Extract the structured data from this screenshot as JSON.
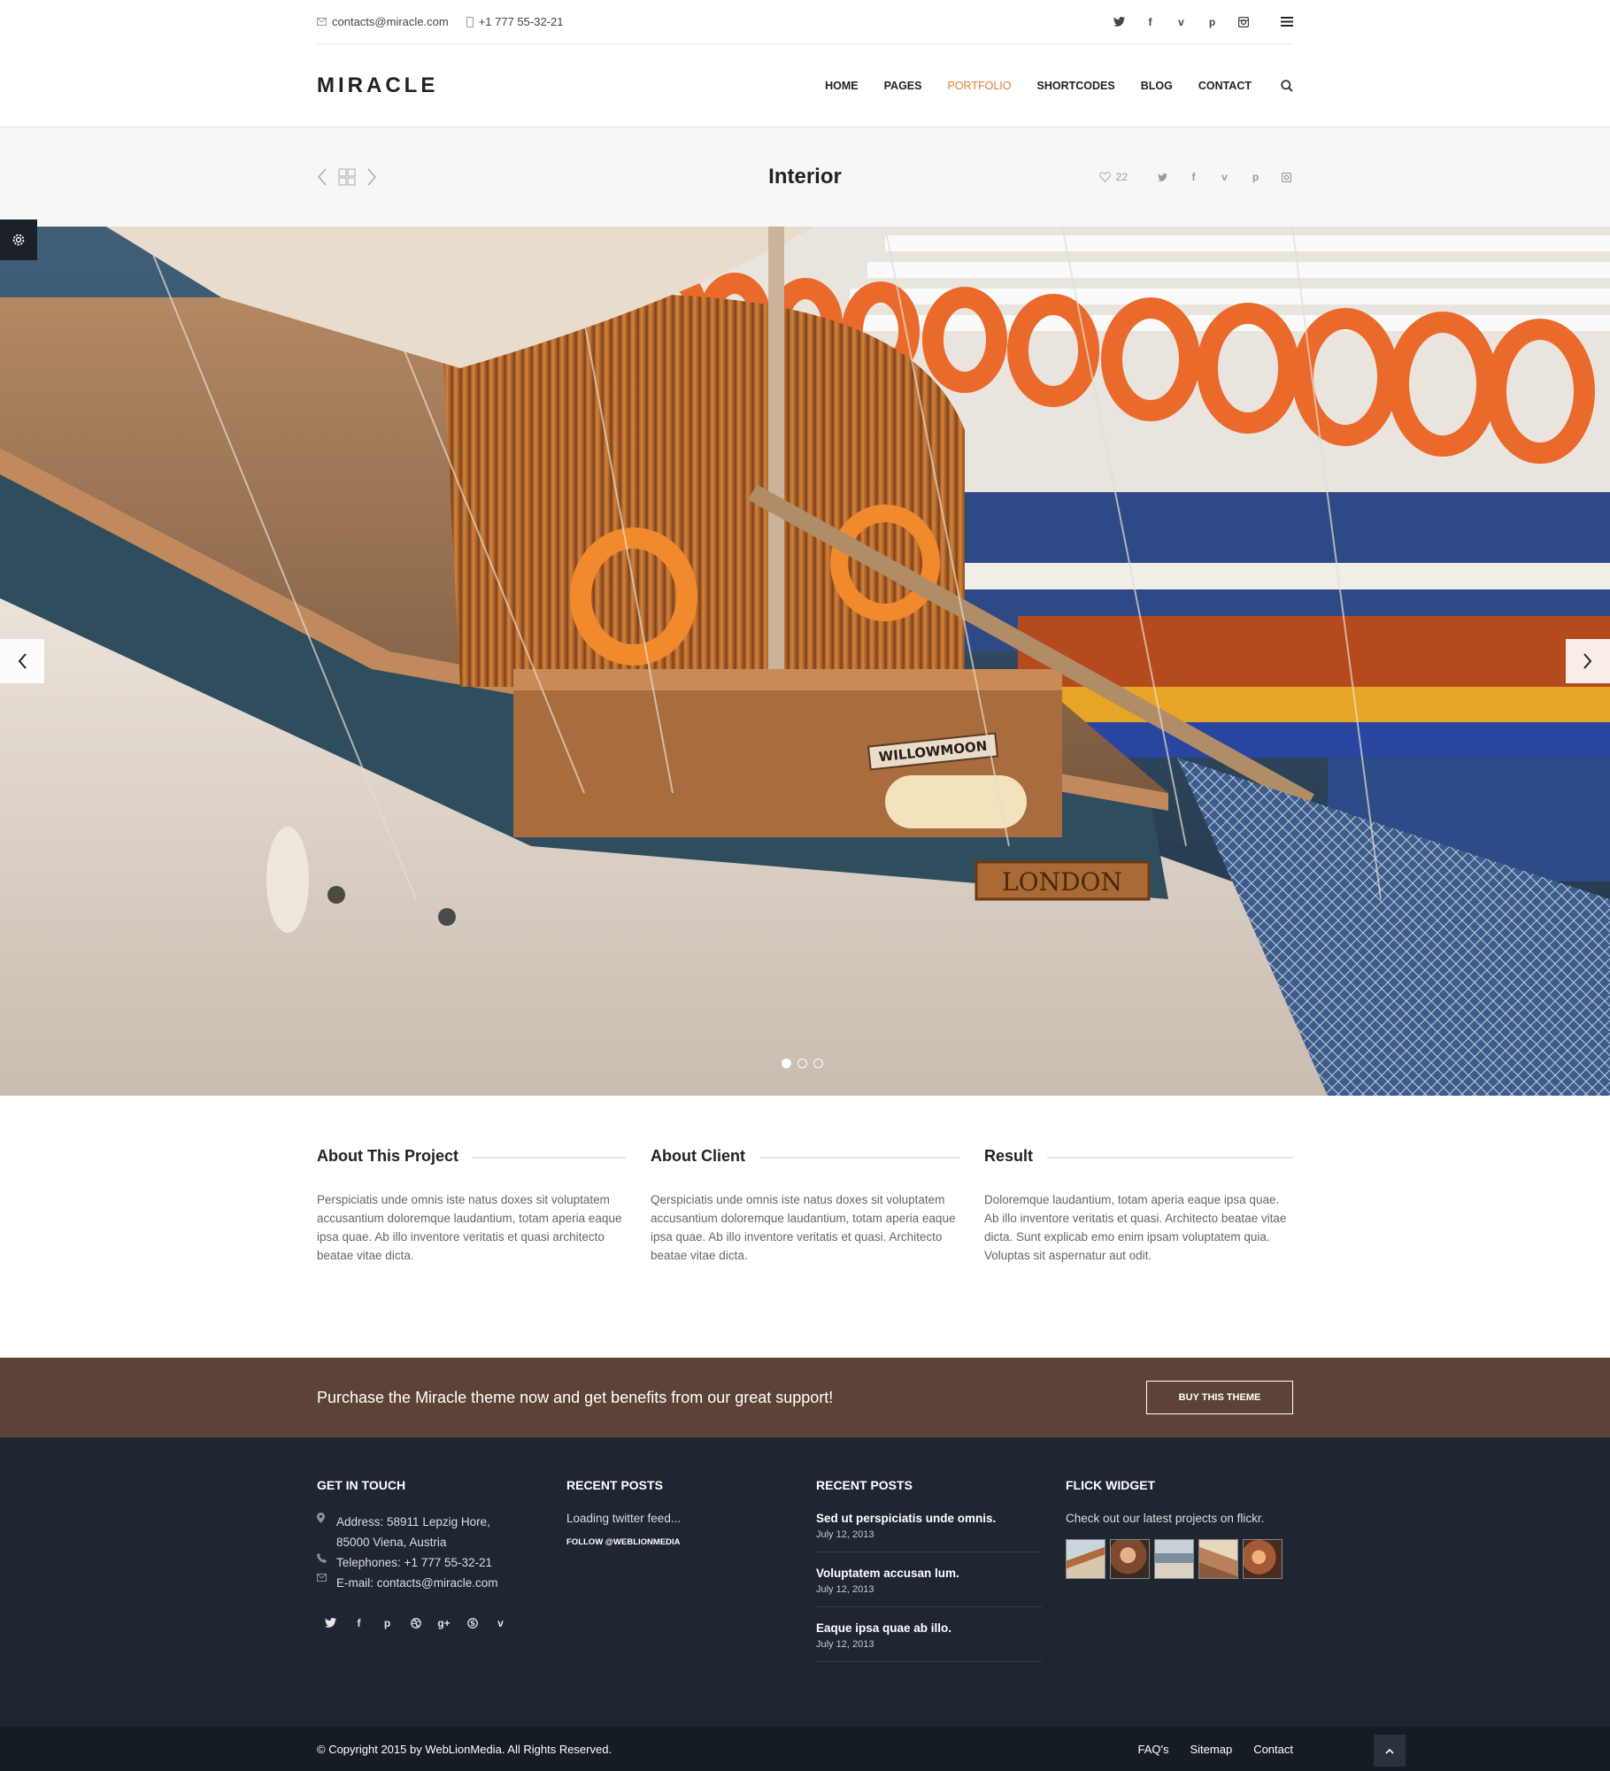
{
  "topbar": {
    "email": "contacts@miracle.com",
    "phone": "+1 777 55-32-21",
    "social": [
      "twitter-icon",
      "facebook-icon",
      "vimeo-icon",
      "pinterest-icon",
      "instagram-icon"
    ]
  },
  "header": {
    "logo": "MIRACLE",
    "nav": [
      "HOME",
      "PAGES",
      "PORTFOLIO",
      "SHORTCODES",
      "BLOG",
      "CONTACT"
    ],
    "active_nav": "PORTFOLIO"
  },
  "titlebar": {
    "title": "Interior",
    "likes": "22"
  },
  "slider": {
    "boat_name": "WILLOWMOON",
    "hull_name": "LONDON",
    "slides": 3,
    "active_slide": 1
  },
  "about": [
    {
      "title": "About This Project",
      "text": "Perspiciatis unde omnis iste natus doxes sit voluptatem accusantium doloremque laudantium, totam aperia eaque ipsa quae. Ab illo inventore veritatis et quasi architecto beatae vitae dicta."
    },
    {
      "title": "About Client",
      "text": "Qerspiciatis unde omnis iste natus doxes sit voluptatem accusantium doloremque laudantium, totam aperia eaque ipsa quae. Ab illo inventore veritatis et quasi. Architecto beatae vitae dicta."
    },
    {
      "title": "Result",
      "text": "Doloremque laudantium, totam aperia eaque ipsa quae. Ab illo inventore veritatis et quasi. Architecto beatae vitae dicta. Sunt explicab emo enim ipsam voluptatem quia. Voluptas sit aspernatur aut odit."
    }
  ],
  "cta": {
    "text": "Purchase the Miracle theme now and get benefits from our great support!",
    "button": "BUY THIS THEME"
  },
  "footer": {
    "get_in_touch": {
      "title": "GET IN TOUCH",
      "address": "Address: 58911 Lepzig Hore,",
      "address2": "85000 Viena, Austria",
      "telephone": "Telephones: +1 777 55-32-21",
      "email": "E-mail: contacts@miracle.com"
    },
    "recent_twitter": {
      "title": "RECENT POSTS",
      "loading": "Loading twitter feed...",
      "follow": "FOLLOW @WEBLIONMEDIA"
    },
    "recent_posts": {
      "title": "RECENT POSTS",
      "posts": [
        {
          "title": "Sed ut perspiciatis unde omnis.",
          "date": "July 12, 2013"
        },
        {
          "title": "Voluptatem accusan lum.",
          "date": "July 12, 2013"
        },
        {
          "title": "Eaque ipsa quae ab illo.",
          "date": "July 12, 2013"
        }
      ]
    },
    "flickr": {
      "title": "FLICK WIDGET",
      "text": "Check out our latest projects on flickr."
    }
  },
  "bottombar": {
    "copyright": "© Copyright 2015 by WebLionMedia. All Rights Reserved.",
    "links": [
      "FAQ's",
      "Sitemap",
      "Contact"
    ]
  }
}
